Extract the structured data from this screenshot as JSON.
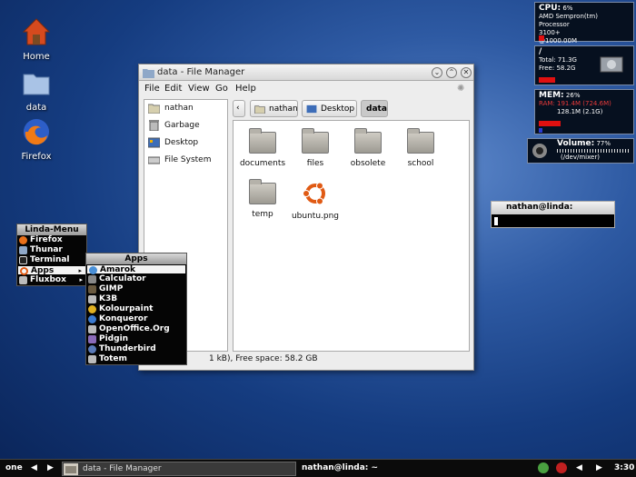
{
  "desktop_icons": [
    {
      "label": "Home",
      "icon": "home-icon"
    },
    {
      "label": "data",
      "icon": "folder-icon"
    },
    {
      "label": "Firefox",
      "icon": "firefox-icon"
    }
  ],
  "conky": {
    "cpu": {
      "label": "CPU:",
      "percent": "6%",
      "model": "AMD Sempron(tm) Processor",
      "model2": "3100+",
      "freq": "@1000.00M"
    },
    "disk": {
      "label": "/",
      "total": "Total: 71.3G",
      "free": "Free: 58.2G"
    },
    "mem": {
      "label": "MEM:",
      "percent": "26%",
      "ram": "RAM: 191.4M (724.6M)",
      "swap": "128.1M (2.1G)"
    },
    "volume": {
      "label": "Volume:",
      "percent": "77%",
      "device": "(/dev/mixer)"
    }
  },
  "window": {
    "title": "data - File Manager",
    "menu": [
      "File",
      "Edit",
      "View",
      "Go",
      "Help"
    ],
    "sidebar": [
      "nathan",
      "Garbage",
      "Desktop",
      "File System"
    ],
    "path": [
      "nathan",
      "Desktop",
      "data"
    ],
    "files": [
      "documents",
      "files",
      "obsolete",
      "school",
      "temp",
      "ubuntu.png"
    ],
    "status": "1 kB), Free space: 58.2 GB"
  },
  "main_menu": {
    "title": "Linda-Menu",
    "items": [
      "Firefox",
      "Thunar",
      "Terminal",
      "Apps",
      "Fluxbox"
    ]
  },
  "apps_menu": {
    "title": "Apps",
    "items": [
      "Amarok",
      "Calculator",
      "GIMP",
      "K3B",
      "Kolourpaint",
      "Konqueror",
      "OpenOffice.Org",
      "Pidgin",
      "Thunderbird",
      "Totem"
    ]
  },
  "terminal": {
    "title": "nathan@linda:"
  },
  "taskbar": {
    "workspace": "one",
    "task": "data - File Manager",
    "title": "nathan@linda: ~",
    "clock": "3:30"
  }
}
